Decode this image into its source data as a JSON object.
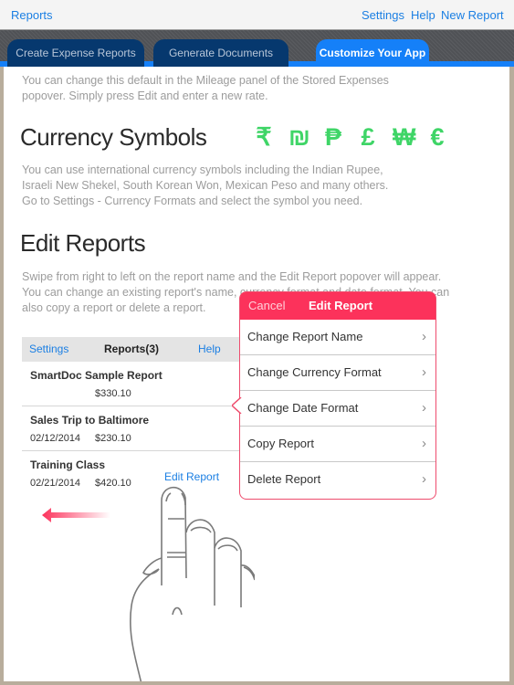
{
  "topnav": {
    "left": "Reports",
    "right": [
      "Settings",
      "Help",
      "New Report"
    ]
  },
  "tabs": [
    {
      "label": "Create Expense Reports",
      "active": false
    },
    {
      "label": "Generate Documents",
      "active": false
    },
    {
      "label": "Customize Your App",
      "active": true
    }
  ],
  "intro": "You can change this default in the Mileage panel of the Stored Expenses popover. Simply press Edit and enter a new rate.",
  "currency": {
    "title": "Currency Symbols",
    "symbols": [
      "₹",
      "₪",
      "₱",
      "£",
      "₩",
      "€"
    ],
    "symbol_color": "#3fd567",
    "description": "You can use international currency symbols including the Indian Rupee, Israeli New Shekel, South Korean Won, Mexican Peso and many others. Go to Settings - Currency Formats and select the symbol you need."
  },
  "edit_reports": {
    "title": "Edit Reports",
    "description": "Swipe from right to left on the report name and the Edit Report popover will appear. You can change an existing report's name, currency format and date format. You can also copy a report or delete a report."
  },
  "report_list": {
    "header": {
      "settings": "Settings",
      "title": "Reports(3)",
      "help": "Help"
    },
    "rows": [
      {
        "name": "SmartDoc Sample Report",
        "date": "",
        "amount": "$330.10",
        "action": ""
      },
      {
        "name": "Sales Trip to Baltimore",
        "date": "02/12/2014",
        "amount": "$230.10",
        "action": ""
      },
      {
        "name": "Training Class",
        "date": "02/21/2014",
        "amount": "$420.10",
        "action": "Edit Report"
      }
    ]
  },
  "popover": {
    "cancel": "Cancel",
    "title": "Edit Report",
    "accent": "#fc325b",
    "items": [
      "Change Report Name",
      "Change Currency Format",
      "Change Date Format",
      "Copy Report",
      "Delete Report"
    ],
    "chevron": "›"
  },
  "gesture": {
    "icon": "swipe-left-hand",
    "direction": "left"
  }
}
